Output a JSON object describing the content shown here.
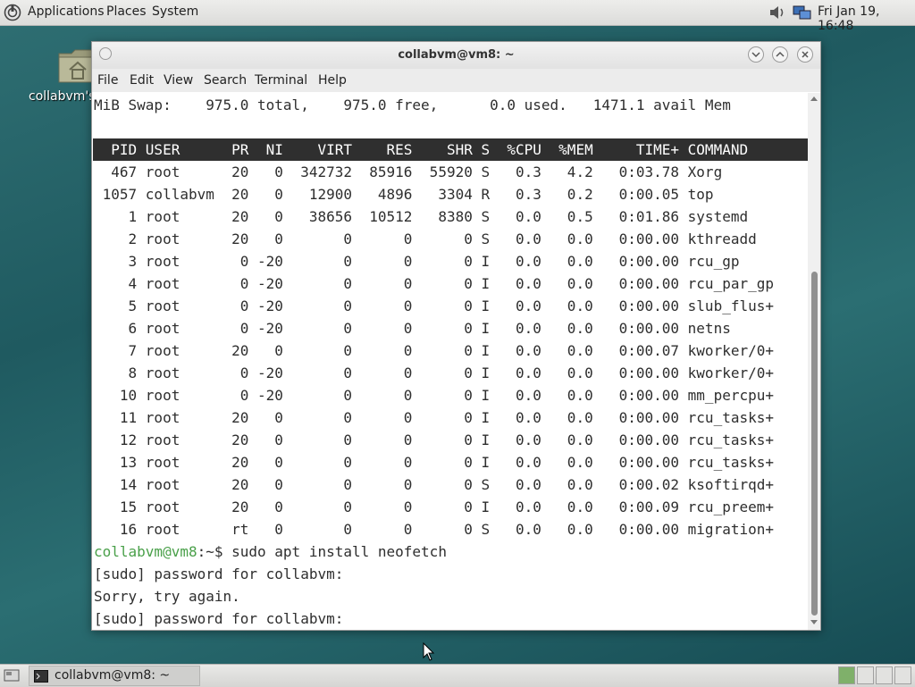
{
  "top_panel": {
    "menus": [
      "Applications",
      "Places",
      "System"
    ],
    "clock": "Fri Jan 19, 16:48"
  },
  "desktop": {
    "home_icon_label": "collabvm's Home"
  },
  "window": {
    "title": "collabvm@vm8: ~",
    "menus": [
      "File",
      "Edit",
      "View",
      "Search",
      "Terminal",
      "Help"
    ]
  },
  "terminal": {
    "swap_line": "MiB Swap:    975.0 total,    975.0 free,      0.0 used.   1471.1 avail Mem",
    "header": "  PID USER      PR  NI    VIRT    RES    SHR S  %CPU  %MEM     TIME+ COMMAND",
    "processes": [
      "  467 root      20   0  342732  85916  55920 S   0.3   4.2   0:03.78 Xorg",
      " 1057 collabvm  20   0   12900   4896   3304 R   0.3   0.2   0:00.05 top",
      "    1 root      20   0   38656  10512   8380 S   0.0   0.5   0:01.86 systemd",
      "    2 root      20   0       0      0      0 S   0.0   0.0   0:00.00 kthreadd",
      "    3 root       0 -20       0      0      0 I   0.0   0.0   0:00.00 rcu_gp",
      "    4 root       0 -20       0      0      0 I   0.0   0.0   0:00.00 rcu_par_gp",
      "    5 root       0 -20       0      0      0 I   0.0   0.0   0:00.00 slub_flus+",
      "    6 root       0 -20       0      0      0 I   0.0   0.0   0:00.00 netns",
      "    7 root      20   0       0      0      0 I   0.0   0.0   0:00.07 kworker/0+",
      "    8 root       0 -20       0      0      0 I   0.0   0.0   0:00.00 kworker/0+",
      "   10 root       0 -20       0      0      0 I   0.0   0.0   0:00.00 mm_percpu+",
      "   11 root      20   0       0      0      0 I   0.0   0.0   0:00.00 rcu_tasks+",
      "   12 root      20   0       0      0      0 I   0.0   0.0   0:00.00 rcu_tasks+",
      "   13 root      20   0       0      0      0 I   0.0   0.0   0:00.00 rcu_tasks+",
      "   14 root      20   0       0      0      0 S   0.0   0.0   0:00.02 ksoftirqd+",
      "   15 root      20   0       0      0      0 I   0.0   0.0   0:00.09 rcu_preem+",
      "   16 root      rt   0       0      0      0 S   0.0   0.0   0:00.00 migration+"
    ],
    "prompt_user": "collabvm@vm8",
    "prompt_rest": ":~$ sudo apt install neofetch",
    "out1": "[sudo] password for collabvm:",
    "out2": "Sorry, try again.",
    "out3": "[sudo] password for collabvm:"
  },
  "taskbar": {
    "task_label": "collabvm@vm8: ~"
  },
  "colors": {
    "prompt_green": "#4aa04a",
    "header_bg": "#2f2f2f"
  }
}
